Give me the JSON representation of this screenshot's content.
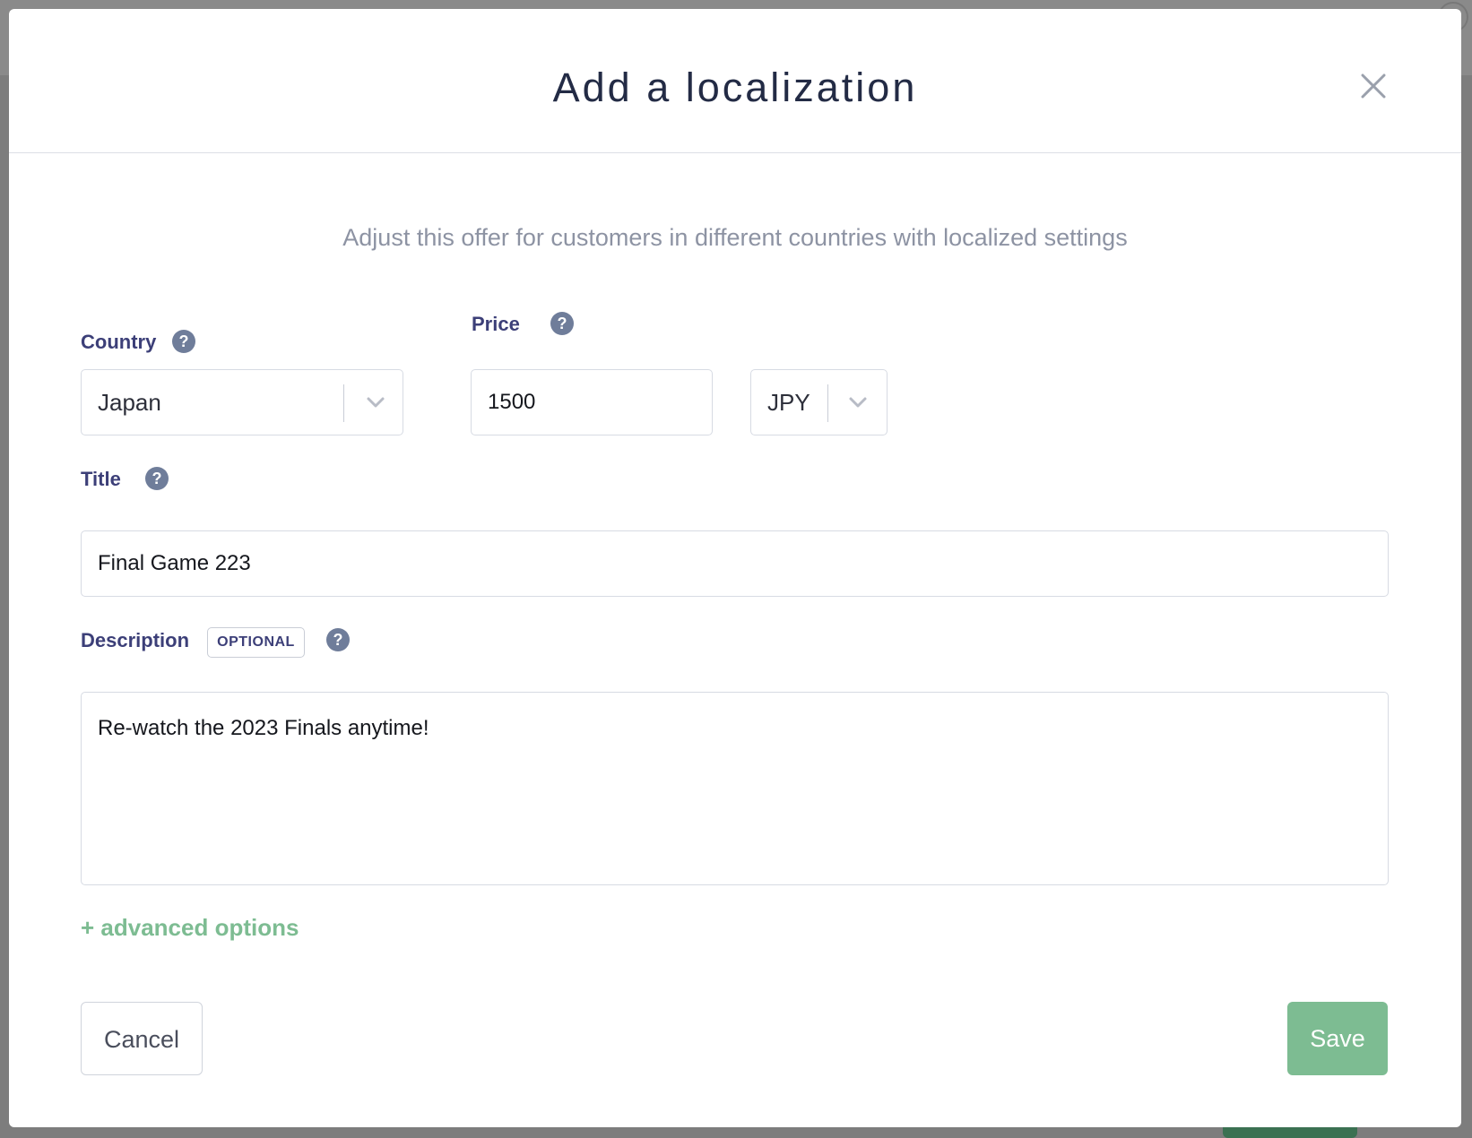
{
  "modal": {
    "title": "Add a localization",
    "subtitle": "Adjust this offer for customers in different countries with localized settings"
  },
  "fields": {
    "country": {
      "label": "Country",
      "value": "Japan"
    },
    "price": {
      "label": "Price",
      "value": "1500",
      "currency": "JPY"
    },
    "title": {
      "label": "Title",
      "value": "Final Game 223"
    },
    "description": {
      "label": "Description",
      "badge": "OPTIONAL",
      "value": "Re-watch the 2023 Finals anytime!"
    }
  },
  "help": {
    "glyph": "?"
  },
  "links": {
    "advanced": "+ advanced options"
  },
  "buttons": {
    "cancel": "Cancel",
    "save": "Save"
  },
  "icons": {
    "close": "close-icon",
    "help": "question-circle-icon",
    "chevron": "chevron-down-icon"
  },
  "colors": {
    "accent": "#7dbc92",
    "label": "#3c3f78",
    "help": "#6f7d9a",
    "title": "#232b45"
  }
}
